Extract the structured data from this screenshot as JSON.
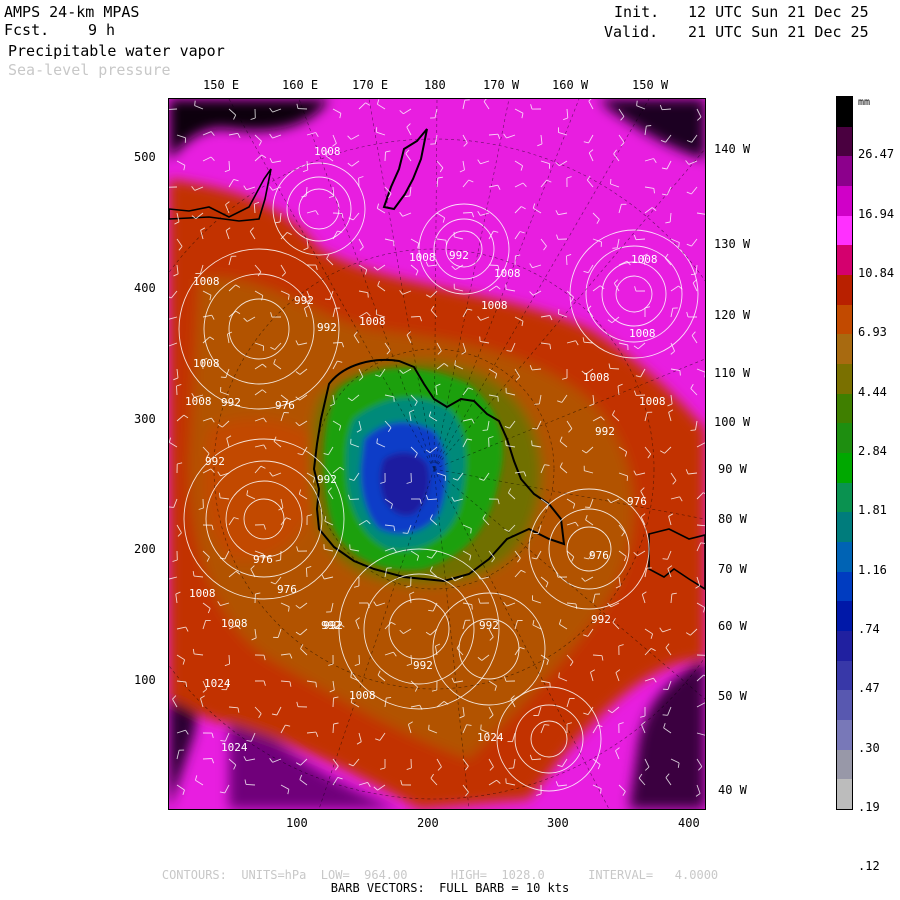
{
  "header": {
    "model": "AMPS 24-km MPAS",
    "fcst_label": "Fcst.",
    "fcst_value": "9 h",
    "init_label": "Init.",
    "init_value": "12 UTC Sun 21 Dec 25",
    "valid_label": "Valid.",
    "valid_value": "21 UTC Sun 21 Dec 25",
    "field_primary": "Precipitable water vapor",
    "field_secondary": "Sea-level pressure"
  },
  "top_longitudes": [
    "150 E",
    "160 E",
    "170 E",
    "180",
    "170 W",
    "160 W",
    "150 W"
  ],
  "right_longitudes": [
    "140 W",
    "130 W",
    "120 W",
    "110 W",
    "100 W",
    "90 W",
    "80 W",
    "70 W",
    "60 W",
    "50 W",
    "40 W"
  ],
  "y_ticks": [
    "500",
    "400",
    "300",
    "200",
    "100"
  ],
  "x_ticks": [
    "100",
    "200",
    "300",
    "400"
  ],
  "colorbar": {
    "units": "mm",
    "labels": [
      "26.47",
      "16.94",
      "10.84",
      "6.93",
      "4.44",
      "2.84",
      "1.81",
      "1.16",
      ".74",
      ".47",
      ".30",
      ".19",
      ".12"
    ],
    "colors": [
      "#000000",
      "#4a0040",
      "#8c008c",
      "#d000c8",
      "#ff30ff",
      "#d4006e",
      "#b82000",
      "#c24a00",
      "#a86a10",
      "#7a7000",
      "#3f7f00",
      "#1e8e10",
      "#00a800",
      "#0a9250",
      "#007c7c",
      "#0063b4",
      "#003cc0",
      "#0018a8",
      "#2020a0",
      "#3838a8",
      "#5858b0",
      "#7878b8",
      "#9898a8",
      "#bcbcbc"
    ]
  },
  "pressure_labels": [
    "1008",
    "1008",
    "1008",
    "1008",
    "1008",
    "1008",
    "1008",
    "1008",
    "1008",
    "1008",
    "1008",
    "1008",
    "1008",
    "1008",
    "1024",
    "1024",
    "1024",
    "992",
    "992",
    "992",
    "992",
    "992",
    "992",
    "992",
    "992",
    "992",
    "992",
    "992",
    "976",
    "976",
    "976",
    "976",
    "976",
    "992",
    "1008"
  ],
  "footer": {
    "contours_line": "CONTOURS:  UNITS=hPa  LOW=  964.00      HIGH=  1028.0      INTERVAL=   4.0000",
    "barb_line": "BARB VECTORS:  FULL BARB = 10 kts"
  }
}
